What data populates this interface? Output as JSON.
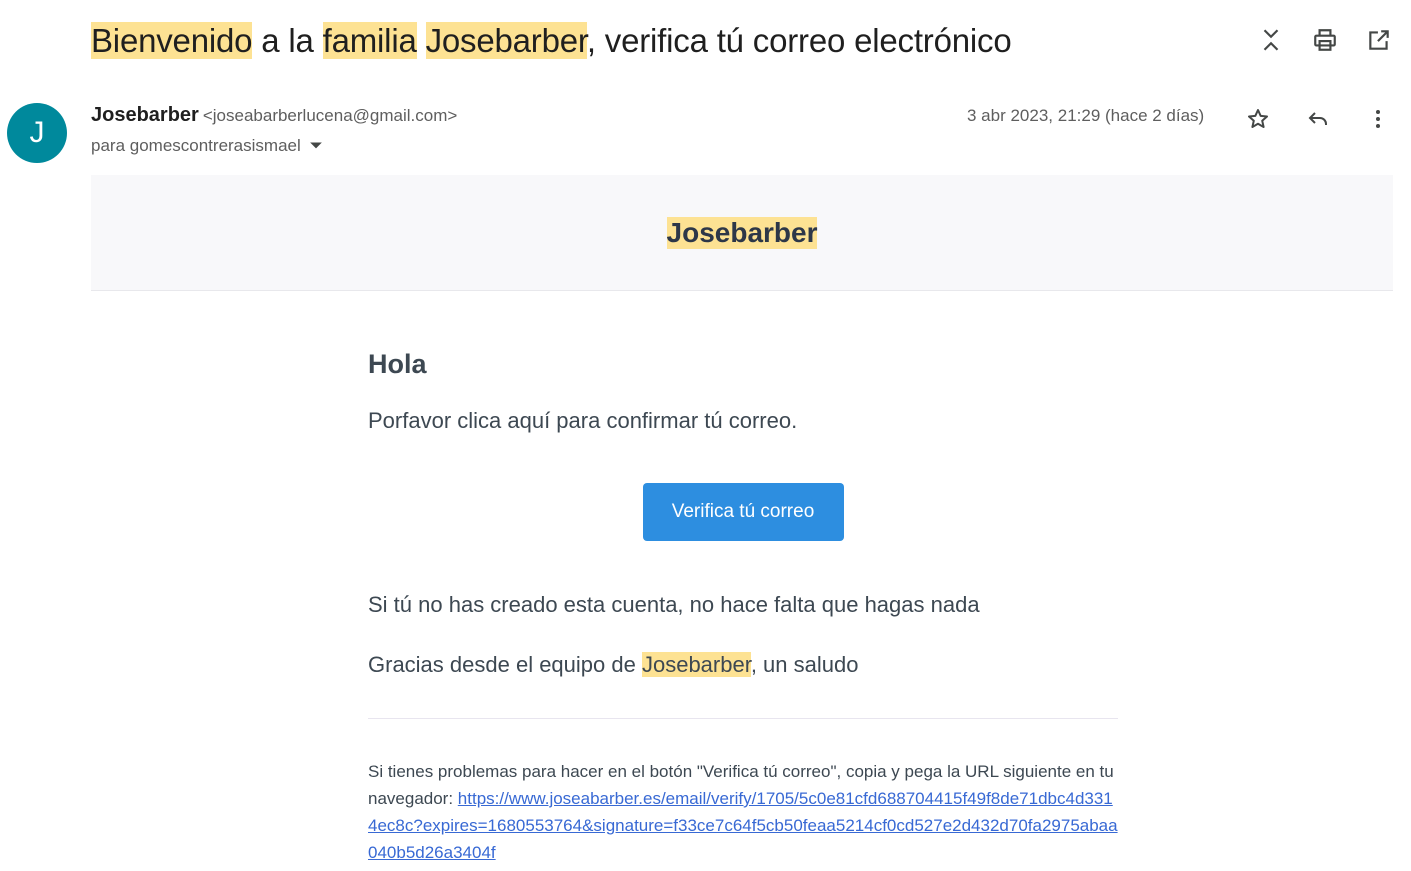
{
  "email": {
    "subject": {
      "parts": [
        "Bienvenido",
        " a la ",
        "familia",
        " ",
        "Josebarber",
        ", verifica tú correo electrónico"
      ]
    },
    "sender": {
      "avatar_letter": "J",
      "avatar_color": "#00899c",
      "name": "Josebarber",
      "email": "<joseabarberlucena@gmail.com>"
    },
    "recipient": "para gomescontrerasismael",
    "date": "3 abr 2023, 21:29 (hace 2 días)"
  },
  "toolbar_icons": [
    "collapse-icon",
    "print-icon",
    "open-in-new-window-icon"
  ],
  "message_icons": [
    "star-icon",
    "reply-icon",
    "more-vert-icon"
  ],
  "body": {
    "brand": "Josebarber",
    "greeting": "Hola",
    "intro": "Porfavor clica aquí para confirmar tú correo.",
    "button_label": "Verifica tú correo",
    "button_color": "#2d8ee0",
    "notice": "Si tú no has creado esta cuenta, no hace falta que hagas nada",
    "thanks": {
      "before": "Gracias desde el equipo de ",
      "brand": "Josebarber",
      "after": ", un saludo"
    },
    "footer_text": "Si tienes problemas para hacer en el botón \"Verifica tú correo\", copia y pega la URL siguiente en tu navegador: ",
    "verify_url": "https://www.joseabarber.es/email/verify/1705/5c0e81cfd688704415f49f8de71dbc4d3314ec8c?expires=1680553764&signature=f33ce7c64f5cb50feaa5214cf0cd527e2d432d70fa2975abaa040b5d26a3404f"
  },
  "highlight_color": "#fde293"
}
